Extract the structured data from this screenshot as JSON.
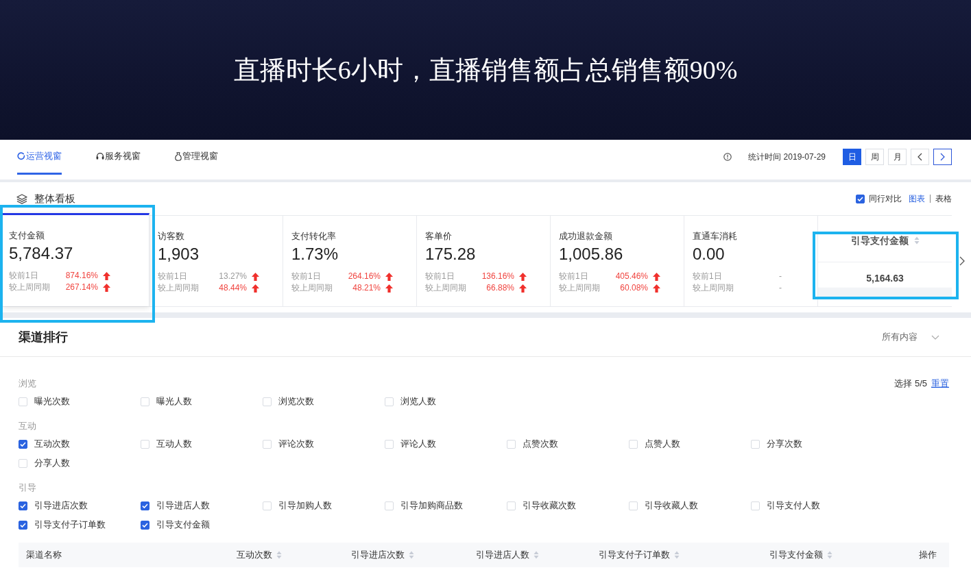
{
  "banner": {
    "title": "直播时长6小时，直播销售额占总销售额90%"
  },
  "nav": {
    "tabs": [
      {
        "label": "运营视窗",
        "selected": true
      },
      {
        "label": "服务视窗",
        "selected": false
      },
      {
        "label": "管理视窗",
        "selected": false
      }
    ],
    "stat_time": "统计时间 2019-07-29",
    "periods": [
      {
        "label": "日",
        "selected": true
      },
      {
        "label": "周",
        "selected": false
      },
      {
        "label": "月",
        "selected": false
      }
    ],
    "pager": [
      {
        "kind": "prev",
        "focused": false
      },
      {
        "kind": "next",
        "focused": true
      }
    ]
  },
  "overview": {
    "title": "整体看板",
    "peer_compare": {
      "label": "同行对比",
      "checked": true
    },
    "views": [
      {
        "label": "图表",
        "selected": true
      },
      {
        "label": "表格",
        "selected": false
      }
    ],
    "cards": [
      {
        "kind": "metric",
        "label": "支付金额",
        "value": "5,784.37",
        "selected": true,
        "annotated": true,
        "comparisons": [
          {
            "label": "较前1日",
            "value": "874.16%",
            "rising": true,
            "muted": false
          },
          {
            "label": "较上周同期",
            "value": "267.14%",
            "rising": true,
            "muted": false
          }
        ]
      },
      {
        "kind": "metric",
        "label": "访客数",
        "value": "1,903",
        "selected": false,
        "annotated": false,
        "comparisons": [
          {
            "label": "较前1日",
            "value": "13.27%",
            "rising": true,
            "muted": true
          },
          {
            "label": "较上周同期",
            "value": "48.44%",
            "rising": true,
            "muted": false
          }
        ]
      },
      {
        "kind": "metric",
        "label": "支付转化率",
        "value": "1.73%",
        "selected": false,
        "annotated": false,
        "comparisons": [
          {
            "label": "较前1日",
            "value": "264.16%",
            "rising": true,
            "muted": false
          },
          {
            "label": "较上周同期",
            "value": "48.21%",
            "rising": true,
            "muted": false
          }
        ]
      },
      {
        "kind": "metric",
        "label": "客单价",
        "value": "175.28",
        "selected": false,
        "annotated": false,
        "comparisons": [
          {
            "label": "较前1日",
            "value": "136.16%",
            "rising": true,
            "muted": false
          },
          {
            "label": "较上周同期",
            "value": "66.88%",
            "rising": true,
            "muted": false
          }
        ]
      },
      {
        "kind": "metric",
        "label": "成功退款金额",
        "value": "1,005.86",
        "selected": false,
        "annotated": false,
        "comparisons": [
          {
            "label": "较前1日",
            "value": "405.46%",
            "rising": true,
            "muted": false
          },
          {
            "label": "较上周同期",
            "value": "60.08%",
            "rising": true,
            "muted": false
          }
        ]
      },
      {
        "kind": "metric",
        "label": "直通车消耗",
        "value": "0.00",
        "selected": false,
        "annotated": false,
        "comparisons": [
          {
            "label": "较前1日",
            "value": "-",
            "rising": false,
            "muted": true
          },
          {
            "label": "较上周同期",
            "value": "-",
            "rising": false,
            "muted": true
          }
        ]
      },
      {
        "kind": "column",
        "label": "引导支付金额",
        "value": "5,164.63",
        "selected": false,
        "annotated": true
      }
    ]
  },
  "channels": {
    "title": "渠道排行",
    "filter": "所有内容",
    "selection": "选择 5/5",
    "reset": "重置",
    "groups": [
      {
        "label": "浏览",
        "options": [
          {
            "label": "曝光次数",
            "checked": false
          },
          {
            "label": "曝光人数",
            "checked": false
          },
          {
            "label": "浏览次数",
            "checked": false
          },
          {
            "label": "浏览人数",
            "checked": false
          }
        ]
      },
      {
        "label": "互动",
        "options": [
          {
            "label": "互动次数",
            "checked": true
          },
          {
            "label": "互动人数",
            "checked": false
          },
          {
            "label": "评论次数",
            "checked": false
          },
          {
            "label": "评论人数",
            "checked": false
          },
          {
            "label": "点赞次数",
            "checked": false
          },
          {
            "label": "点赞人数",
            "checked": false
          },
          {
            "label": "分享次数",
            "checked": false
          },
          {
            "label": "分享人数",
            "checked": false
          }
        ]
      },
      {
        "label": "引导",
        "options": [
          {
            "label": "引导进店次数",
            "checked": true
          },
          {
            "label": "引导进店人数",
            "checked": true
          },
          {
            "label": "引导加购人数",
            "checked": false
          },
          {
            "label": "引导加购商品数",
            "checked": false
          },
          {
            "label": "引导收藏次数",
            "checked": false
          },
          {
            "label": "引导收藏人数",
            "checked": false
          },
          {
            "label": "引导支付人数",
            "checked": false
          },
          {
            "label": "引导支付子订单数",
            "checked": true
          },
          {
            "label": "引导支付金额",
            "checked": true
          }
        ]
      }
    ],
    "table": {
      "columns": [
        {
          "label": "渠道名称",
          "sortable": false
        },
        {
          "label": "互动次数",
          "sortable": true
        },
        {
          "label": "引导进店次数",
          "sortable": true
        },
        {
          "label": "引导进店人数",
          "sortable": true
        },
        {
          "label": "引导支付子订单数",
          "sortable": true
        },
        {
          "label": "引导支付金额",
          "sortable": true
        },
        {
          "label": "操作",
          "sortable": false
        }
      ]
    }
  }
}
